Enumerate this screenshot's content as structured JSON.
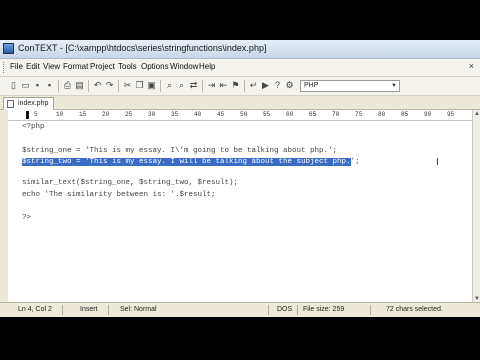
{
  "titlebar": {
    "title": "ConTEXT - [C:\\xampp\\htdocs\\series\\stringfunctions\\index.php]"
  },
  "menu": {
    "items": [
      "File",
      "Edit",
      "View",
      "Format",
      "Project",
      "Tools",
      "Options",
      "Window",
      "Help"
    ],
    "close": "×"
  },
  "toolbar": {
    "language": "PHP"
  },
  "tab": {
    "label": "index.php"
  },
  "ruler": {
    "labels": [
      "5",
      "10",
      "15",
      "20",
      "25",
      "30",
      "35",
      "40",
      "45",
      "50",
      "55",
      "60",
      "65",
      "70",
      "75",
      "80",
      "85",
      "90",
      "95"
    ]
  },
  "editor": {
    "lines": {
      "l1": "<?php",
      "l3": "$string_one = 'This is my essay. I\\'m going to be talking about php.';",
      "l4_sel": "$string_two = 'This is my essay. I will be talking about the subject php.",
      "l4_rest": "';",
      "l6": "similar_text($string_one, $string_two, $result);",
      "l7": "echo 'The similarity between is: '.$result;",
      "l9": "?>"
    },
    "selection_color": "#3b6cc4"
  },
  "status": {
    "position": "Ln 4, Col 2",
    "mode": "Insert",
    "selection_mode": "Sel: Normal",
    "line_endings": "DOS",
    "file_size": "File size: 259",
    "selected_info": "72 chars selected."
  }
}
